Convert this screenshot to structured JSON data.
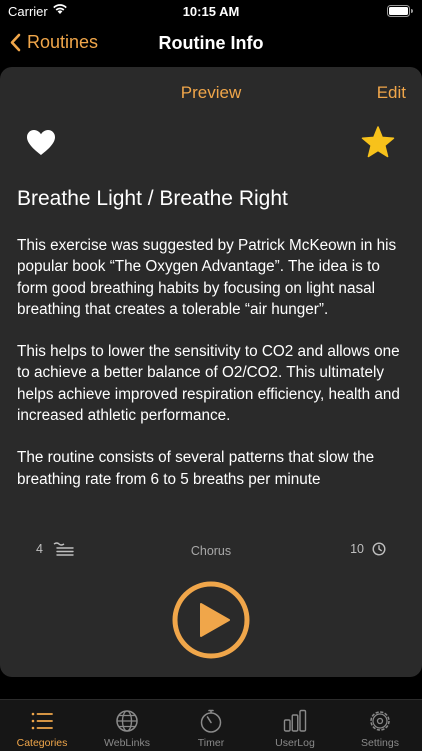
{
  "status_bar": {
    "carrier": "Carrier",
    "time": "10:15 AM"
  },
  "nav": {
    "back_label": "Routines",
    "title": "Routine Info"
  },
  "card": {
    "preview_label": "Preview",
    "edit_label": "Edit",
    "favorite_icon": "heart-icon",
    "rating_icon": "star-icon",
    "title": "Breathe Light / Breathe Right",
    "description": [
      "This exercise was suggested by Patrick McKeown in his popular book “The Oxygen Advantage”.  The idea is to form good breathing habits by focusing on light nasal breathing that creates a tolerable “air hunger”.",
      "This helps to lower the sensitivity to CO2 and allows one to achieve a better balance of O2/CO2. This ultimately helps achieve improved respiration efficiency, health and increased athletic performance.",
      "The routine consists of several patterns that slow the breathing rate from 6 to 5 breaths per minute"
    ],
    "stats": {
      "patterns_count": "4",
      "sound": "Chorus",
      "duration": "10"
    }
  },
  "tabs": [
    {
      "label": "Categories",
      "icon": "list-icon",
      "active": true
    },
    {
      "label": "WebLinks",
      "icon": "globe-icon",
      "active": false
    },
    {
      "label": "Timer",
      "icon": "stopwatch-icon",
      "active": false
    },
    {
      "label": "UserLog",
      "icon": "bar-chart-icon",
      "active": false
    },
    {
      "label": "Settings",
      "icon": "gear-icon",
      "active": false
    }
  ],
  "colors": {
    "accent": "#f0a64a",
    "star": "#f7c21b",
    "background": "#000000",
    "card": "#2a2a2a"
  }
}
